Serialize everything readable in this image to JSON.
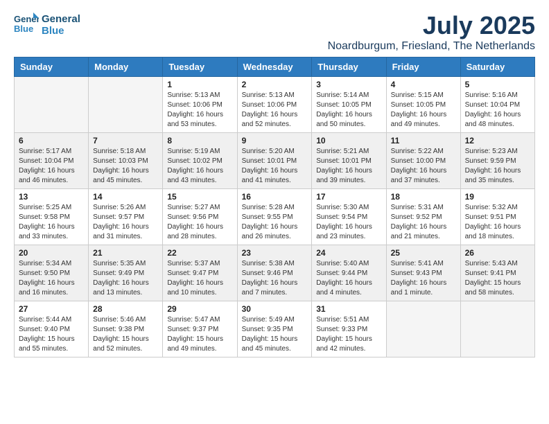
{
  "header": {
    "logo_line1": "General",
    "logo_line2": "Blue",
    "month": "July 2025",
    "location": "Noardburgum, Friesland, The Netherlands"
  },
  "weekdays": [
    "Sunday",
    "Monday",
    "Tuesday",
    "Wednesday",
    "Thursday",
    "Friday",
    "Saturday"
  ],
  "weeks": [
    [
      {
        "day": "",
        "info": ""
      },
      {
        "day": "",
        "info": ""
      },
      {
        "day": "1",
        "info": "Sunrise: 5:13 AM\nSunset: 10:06 PM\nDaylight: 16 hours\nand 53 minutes."
      },
      {
        "day": "2",
        "info": "Sunrise: 5:13 AM\nSunset: 10:06 PM\nDaylight: 16 hours\nand 52 minutes."
      },
      {
        "day": "3",
        "info": "Sunrise: 5:14 AM\nSunset: 10:05 PM\nDaylight: 16 hours\nand 50 minutes."
      },
      {
        "day": "4",
        "info": "Sunrise: 5:15 AM\nSunset: 10:05 PM\nDaylight: 16 hours\nand 49 minutes."
      },
      {
        "day": "5",
        "info": "Sunrise: 5:16 AM\nSunset: 10:04 PM\nDaylight: 16 hours\nand 48 minutes."
      }
    ],
    [
      {
        "day": "6",
        "info": "Sunrise: 5:17 AM\nSunset: 10:04 PM\nDaylight: 16 hours\nand 46 minutes."
      },
      {
        "day": "7",
        "info": "Sunrise: 5:18 AM\nSunset: 10:03 PM\nDaylight: 16 hours\nand 45 minutes."
      },
      {
        "day": "8",
        "info": "Sunrise: 5:19 AM\nSunset: 10:02 PM\nDaylight: 16 hours\nand 43 minutes."
      },
      {
        "day": "9",
        "info": "Sunrise: 5:20 AM\nSunset: 10:01 PM\nDaylight: 16 hours\nand 41 minutes."
      },
      {
        "day": "10",
        "info": "Sunrise: 5:21 AM\nSunset: 10:01 PM\nDaylight: 16 hours\nand 39 minutes."
      },
      {
        "day": "11",
        "info": "Sunrise: 5:22 AM\nSunset: 10:00 PM\nDaylight: 16 hours\nand 37 minutes."
      },
      {
        "day": "12",
        "info": "Sunrise: 5:23 AM\nSunset: 9:59 PM\nDaylight: 16 hours\nand 35 minutes."
      }
    ],
    [
      {
        "day": "13",
        "info": "Sunrise: 5:25 AM\nSunset: 9:58 PM\nDaylight: 16 hours\nand 33 minutes."
      },
      {
        "day": "14",
        "info": "Sunrise: 5:26 AM\nSunset: 9:57 PM\nDaylight: 16 hours\nand 31 minutes."
      },
      {
        "day": "15",
        "info": "Sunrise: 5:27 AM\nSunset: 9:56 PM\nDaylight: 16 hours\nand 28 minutes."
      },
      {
        "day": "16",
        "info": "Sunrise: 5:28 AM\nSunset: 9:55 PM\nDaylight: 16 hours\nand 26 minutes."
      },
      {
        "day": "17",
        "info": "Sunrise: 5:30 AM\nSunset: 9:54 PM\nDaylight: 16 hours\nand 23 minutes."
      },
      {
        "day": "18",
        "info": "Sunrise: 5:31 AM\nSunset: 9:52 PM\nDaylight: 16 hours\nand 21 minutes."
      },
      {
        "day": "19",
        "info": "Sunrise: 5:32 AM\nSunset: 9:51 PM\nDaylight: 16 hours\nand 18 minutes."
      }
    ],
    [
      {
        "day": "20",
        "info": "Sunrise: 5:34 AM\nSunset: 9:50 PM\nDaylight: 16 hours\nand 16 minutes."
      },
      {
        "day": "21",
        "info": "Sunrise: 5:35 AM\nSunset: 9:49 PM\nDaylight: 16 hours\nand 13 minutes."
      },
      {
        "day": "22",
        "info": "Sunrise: 5:37 AM\nSunset: 9:47 PM\nDaylight: 16 hours\nand 10 minutes."
      },
      {
        "day": "23",
        "info": "Sunrise: 5:38 AM\nSunset: 9:46 PM\nDaylight: 16 hours\nand 7 minutes."
      },
      {
        "day": "24",
        "info": "Sunrise: 5:40 AM\nSunset: 9:44 PM\nDaylight: 16 hours\nand 4 minutes."
      },
      {
        "day": "25",
        "info": "Sunrise: 5:41 AM\nSunset: 9:43 PM\nDaylight: 16 hours\nand 1 minute."
      },
      {
        "day": "26",
        "info": "Sunrise: 5:43 AM\nSunset: 9:41 PM\nDaylight: 15 hours\nand 58 minutes."
      }
    ],
    [
      {
        "day": "27",
        "info": "Sunrise: 5:44 AM\nSunset: 9:40 PM\nDaylight: 15 hours\nand 55 minutes."
      },
      {
        "day": "28",
        "info": "Sunrise: 5:46 AM\nSunset: 9:38 PM\nDaylight: 15 hours\nand 52 minutes."
      },
      {
        "day": "29",
        "info": "Sunrise: 5:47 AM\nSunset: 9:37 PM\nDaylight: 15 hours\nand 49 minutes."
      },
      {
        "day": "30",
        "info": "Sunrise: 5:49 AM\nSunset: 9:35 PM\nDaylight: 15 hours\nand 45 minutes."
      },
      {
        "day": "31",
        "info": "Sunrise: 5:51 AM\nSunset: 9:33 PM\nDaylight: 15 hours\nand 42 minutes."
      },
      {
        "day": "",
        "info": ""
      },
      {
        "day": "",
        "info": ""
      }
    ]
  ]
}
